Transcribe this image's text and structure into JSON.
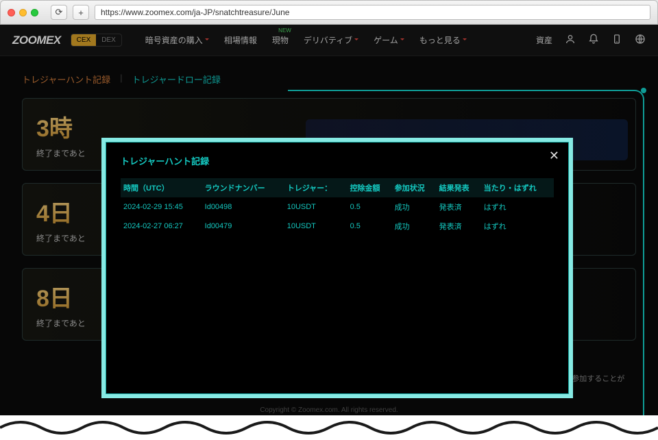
{
  "browser": {
    "url": "https://www.zoomex.com/ja-JP/snatchtreasure/June"
  },
  "nav": {
    "logo": "ZOOMEX",
    "mode_cex": "CEX",
    "mode_dex": "DEX",
    "items": {
      "buy": "暗号資産の購入",
      "market": "相場情報",
      "spot": "現物",
      "deriv": "デリバティブ",
      "game": "ゲーム",
      "more": "もっと見る",
      "spot_new": "NEW"
    },
    "right": {
      "assets": "資産"
    }
  },
  "records": {
    "tab_hunt": "トレジャーハント記録",
    "tab_draw": "トレジャードロー記録"
  },
  "cards": {
    "c1_big": "3時",
    "c1_sub": "終了まであと",
    "c2_big": "4日",
    "c2_sub": "終了まであと",
    "c3_big": "8日",
    "c3_sub": "終了まであと"
  },
  "modal": {
    "title": "トレジャーハント記録",
    "headers": {
      "time": "時間（UTC）",
      "round": "ラウンドナンバー",
      "treasure": "トレジャー：",
      "deduct": "控除金額",
      "status": "参加状況",
      "result": "結果発表",
      "winlose": "当たり・はずれ"
    },
    "rows": [
      {
        "time": "2024-02-29 15:45",
        "round": "Id00498",
        "treasure": "10USDT",
        "deduct": "0.5",
        "status": "成功",
        "result": "発表済",
        "winlose": "はずれ"
      },
      {
        "time": "2024-02-27 06:27",
        "round": "Id00479",
        "treasure": "10USDT",
        "deduct": "0.5",
        "status": "成功",
        "result": "発表済",
        "winlose": "はずれ"
      }
    ]
  },
  "footer": {
    "hint": "参加方法：現金またはトレジャーチケットで、参加登録後にトレジャーハントに参加することができます",
    "copy": "Copyright © Zoomex.com. All rights reserved."
  }
}
